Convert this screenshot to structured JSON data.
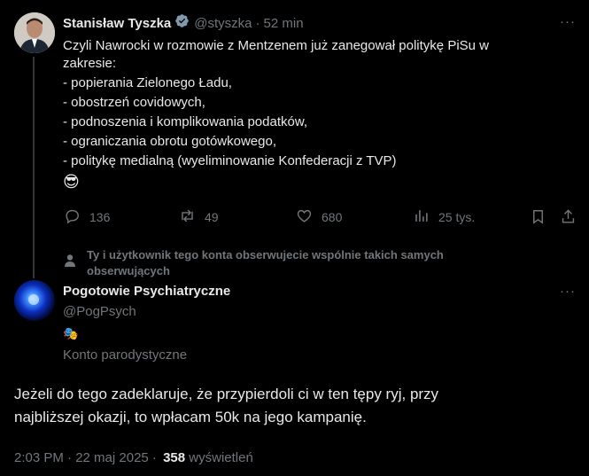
{
  "tweet1": {
    "author_name": "Stanisław Tyszka",
    "handle": "@styszka",
    "separator": "·",
    "time": "52 min",
    "lines": [
      "Czyli Nawrocki w rozmowie z Mentzenem już zanegował politykę PiSu w",
      "zakresie:",
      "- popierania Zielonego Ładu,",
      "- obostrzeń covidowych,",
      "- podnoszenia i komplikowania podatków,",
      "- ograniczania obrotu gotówkowego,",
      "- politykę medialną (wyeliminowanie Konfederacji z TVP)"
    ],
    "emoji": "😎",
    "stats": {
      "replies": "136",
      "reposts": "49",
      "likes": "680",
      "views": "25 tys."
    }
  },
  "social_context": {
    "line1": "Ty i użytkownik tego konta obserwujecie wspólnie takich samych",
    "line2": "obserwujących"
  },
  "tweet2": {
    "author_name": "Pogotowie Psychiatryczne",
    "handle": "@PogPsych",
    "badge_emoji": "🎭",
    "label": "Konto parodystyczne",
    "line1": "Jeżeli do tego zadeklaruje, że przypierdoli ci w ten tępy ryj, przy",
    "line2": "najbliższej okazji, to wpłacam 50k na jego kampanię.",
    "timestamp": "2:03 PM · 22 maj 2025 ·",
    "views_count": "358",
    "views_label": "wyświetleń"
  },
  "more_glyph": "···",
  "colors": {
    "background": "#000000",
    "text": "#e7e9ea",
    "muted": "#71767b",
    "verified": "#829aab",
    "thread_line": "#333639"
  }
}
